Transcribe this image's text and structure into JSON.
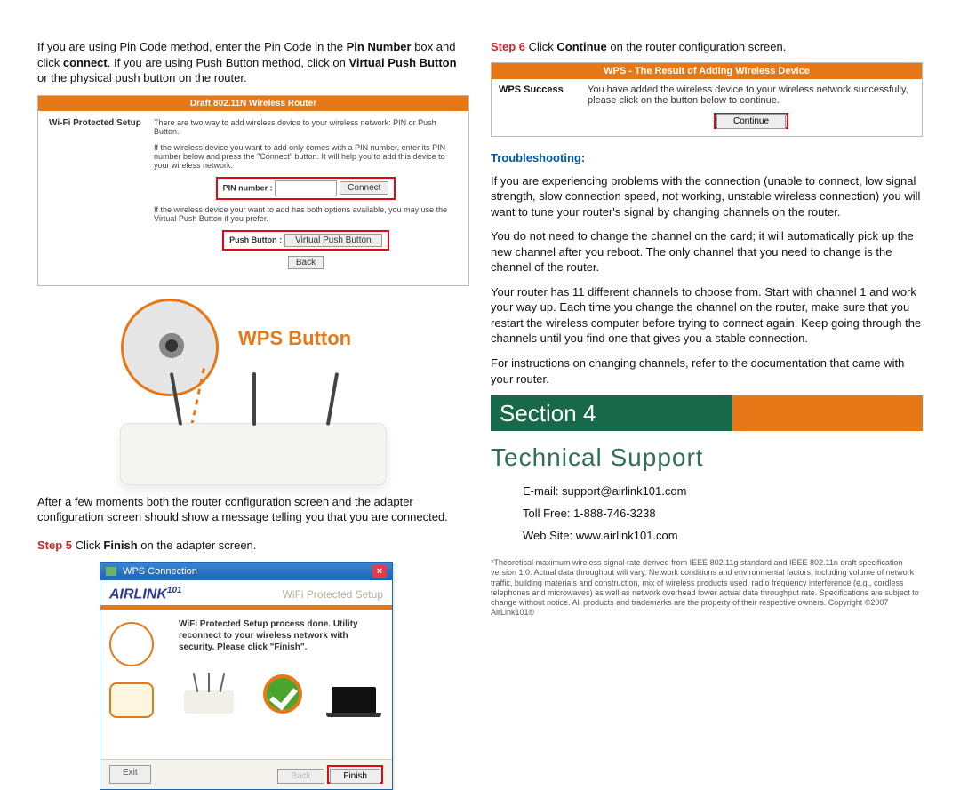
{
  "left": {
    "intro": {
      "t1": "If you are using Pin Code method, enter the Pin Code in the ",
      "pin_number": "Pin Number",
      "t2": " box and click ",
      "connect": "connect",
      "t3": ".  If you are using Push Button method, click on ",
      "vpb": "Virtual Push Button",
      "t4": " or the physical push button on the router."
    },
    "rcfg": {
      "header": "Draft 802.11N Wireless Router",
      "label": "Wi-Fi Protected Setup",
      "desc1": "There are two way to add wireless device to your wireless network: PIN or Push Button.",
      "desc2": "If the wireless device you want to add only comes with a PIN number, enter its PIN number below and press the \"Connect\" button. It will help you to add this device to your wireless network.",
      "pin_label": "PIN number :",
      "connect_btn": "Connect",
      "desc3": "If the wireless device your want to add has both options available, you may use the Virtual Push Button if you prefer.",
      "pb_label": "Push Button :",
      "vpb_btn": "Virtual Push Button",
      "back_btn": "Back"
    },
    "wps_button_label": "WPS Button",
    "after_text": "After a few moments both the router configuration screen and the adapter configuration screen should show a message telling you that you are connected.",
    "step5_label": "Step 5",
    "step5_text_a": " Click ",
    "step5_bold": "Finish",
    "step5_text_b": " on the adapter screen.",
    "wps_window": {
      "title": "WPS Connection",
      "brand": "AIRLINK",
      "brand_sup": "101",
      "subtitle": "WiFi Protected Setup",
      "msg": "WiFi Protected Setup process done. Utility reconnect to your wireless network with security. Please click \"Finish\".",
      "exit": "Exit",
      "back": "Back",
      "finish": "Finish"
    }
  },
  "right": {
    "step6_label": "Step 6",
    "step6_a": " Click ",
    "step6_bold": "Continue",
    "step6_b": " on the router configuration screen.",
    "succ_header": "WPS - The Result of Adding Wireless Device",
    "succ_label": "WPS Success",
    "succ_msg": "You have added the wireless device to your wireless network successfully, please click on the button below to continue.",
    "continue_btn": "Continue",
    "trouble_heading": "Troubleshooting:",
    "p1": "If you are experiencing problems with the connection (unable to connect, low signal strength, slow connection speed, not working, unstable wireless connection) you will want to tune your router's signal by changing channels on the router.",
    "p2": "You do not need to change the channel on the card; it will automatically pick up the new channel after you reboot.  The only channel that you need to change is the channel of the router.",
    "p3": "Your router has 11 different channels to choose from.  Start with channel 1 and work your way up.  Each time you change the channel on the router, make sure that you restart the wireless computer before trying to connect again.  Keep going through the channels until you find one that gives you a stable connection.",
    "p4": "For instructions on changing channels, refer to the documentation that came with your router.",
    "section_banner": "Section 4",
    "support_heading": "Technical  Support",
    "email": "E-mail: support@airlink101.com",
    "toll": "Toll Free: 1-888-746-3238",
    "web": "Web Site: www.airlink101.com",
    "fineprint": "*Theoretical maximum wireless signal rate derived from IEEE 802.11g standard and IEEE 802.11n draft specification version 1.0. Actual data throughput will vary. Network conditions and environmental factors, including volume of network traffic, building materials and construction, mix of wireless products used, radio frequency interference (e.g., cordless telephones and microwaves) as well as network overhead lower actual data throughput rate. Specifications are subject to change without notice. All products and trademarks are the property of their respective owners. Copyright ©2007 AirLink101®"
  }
}
